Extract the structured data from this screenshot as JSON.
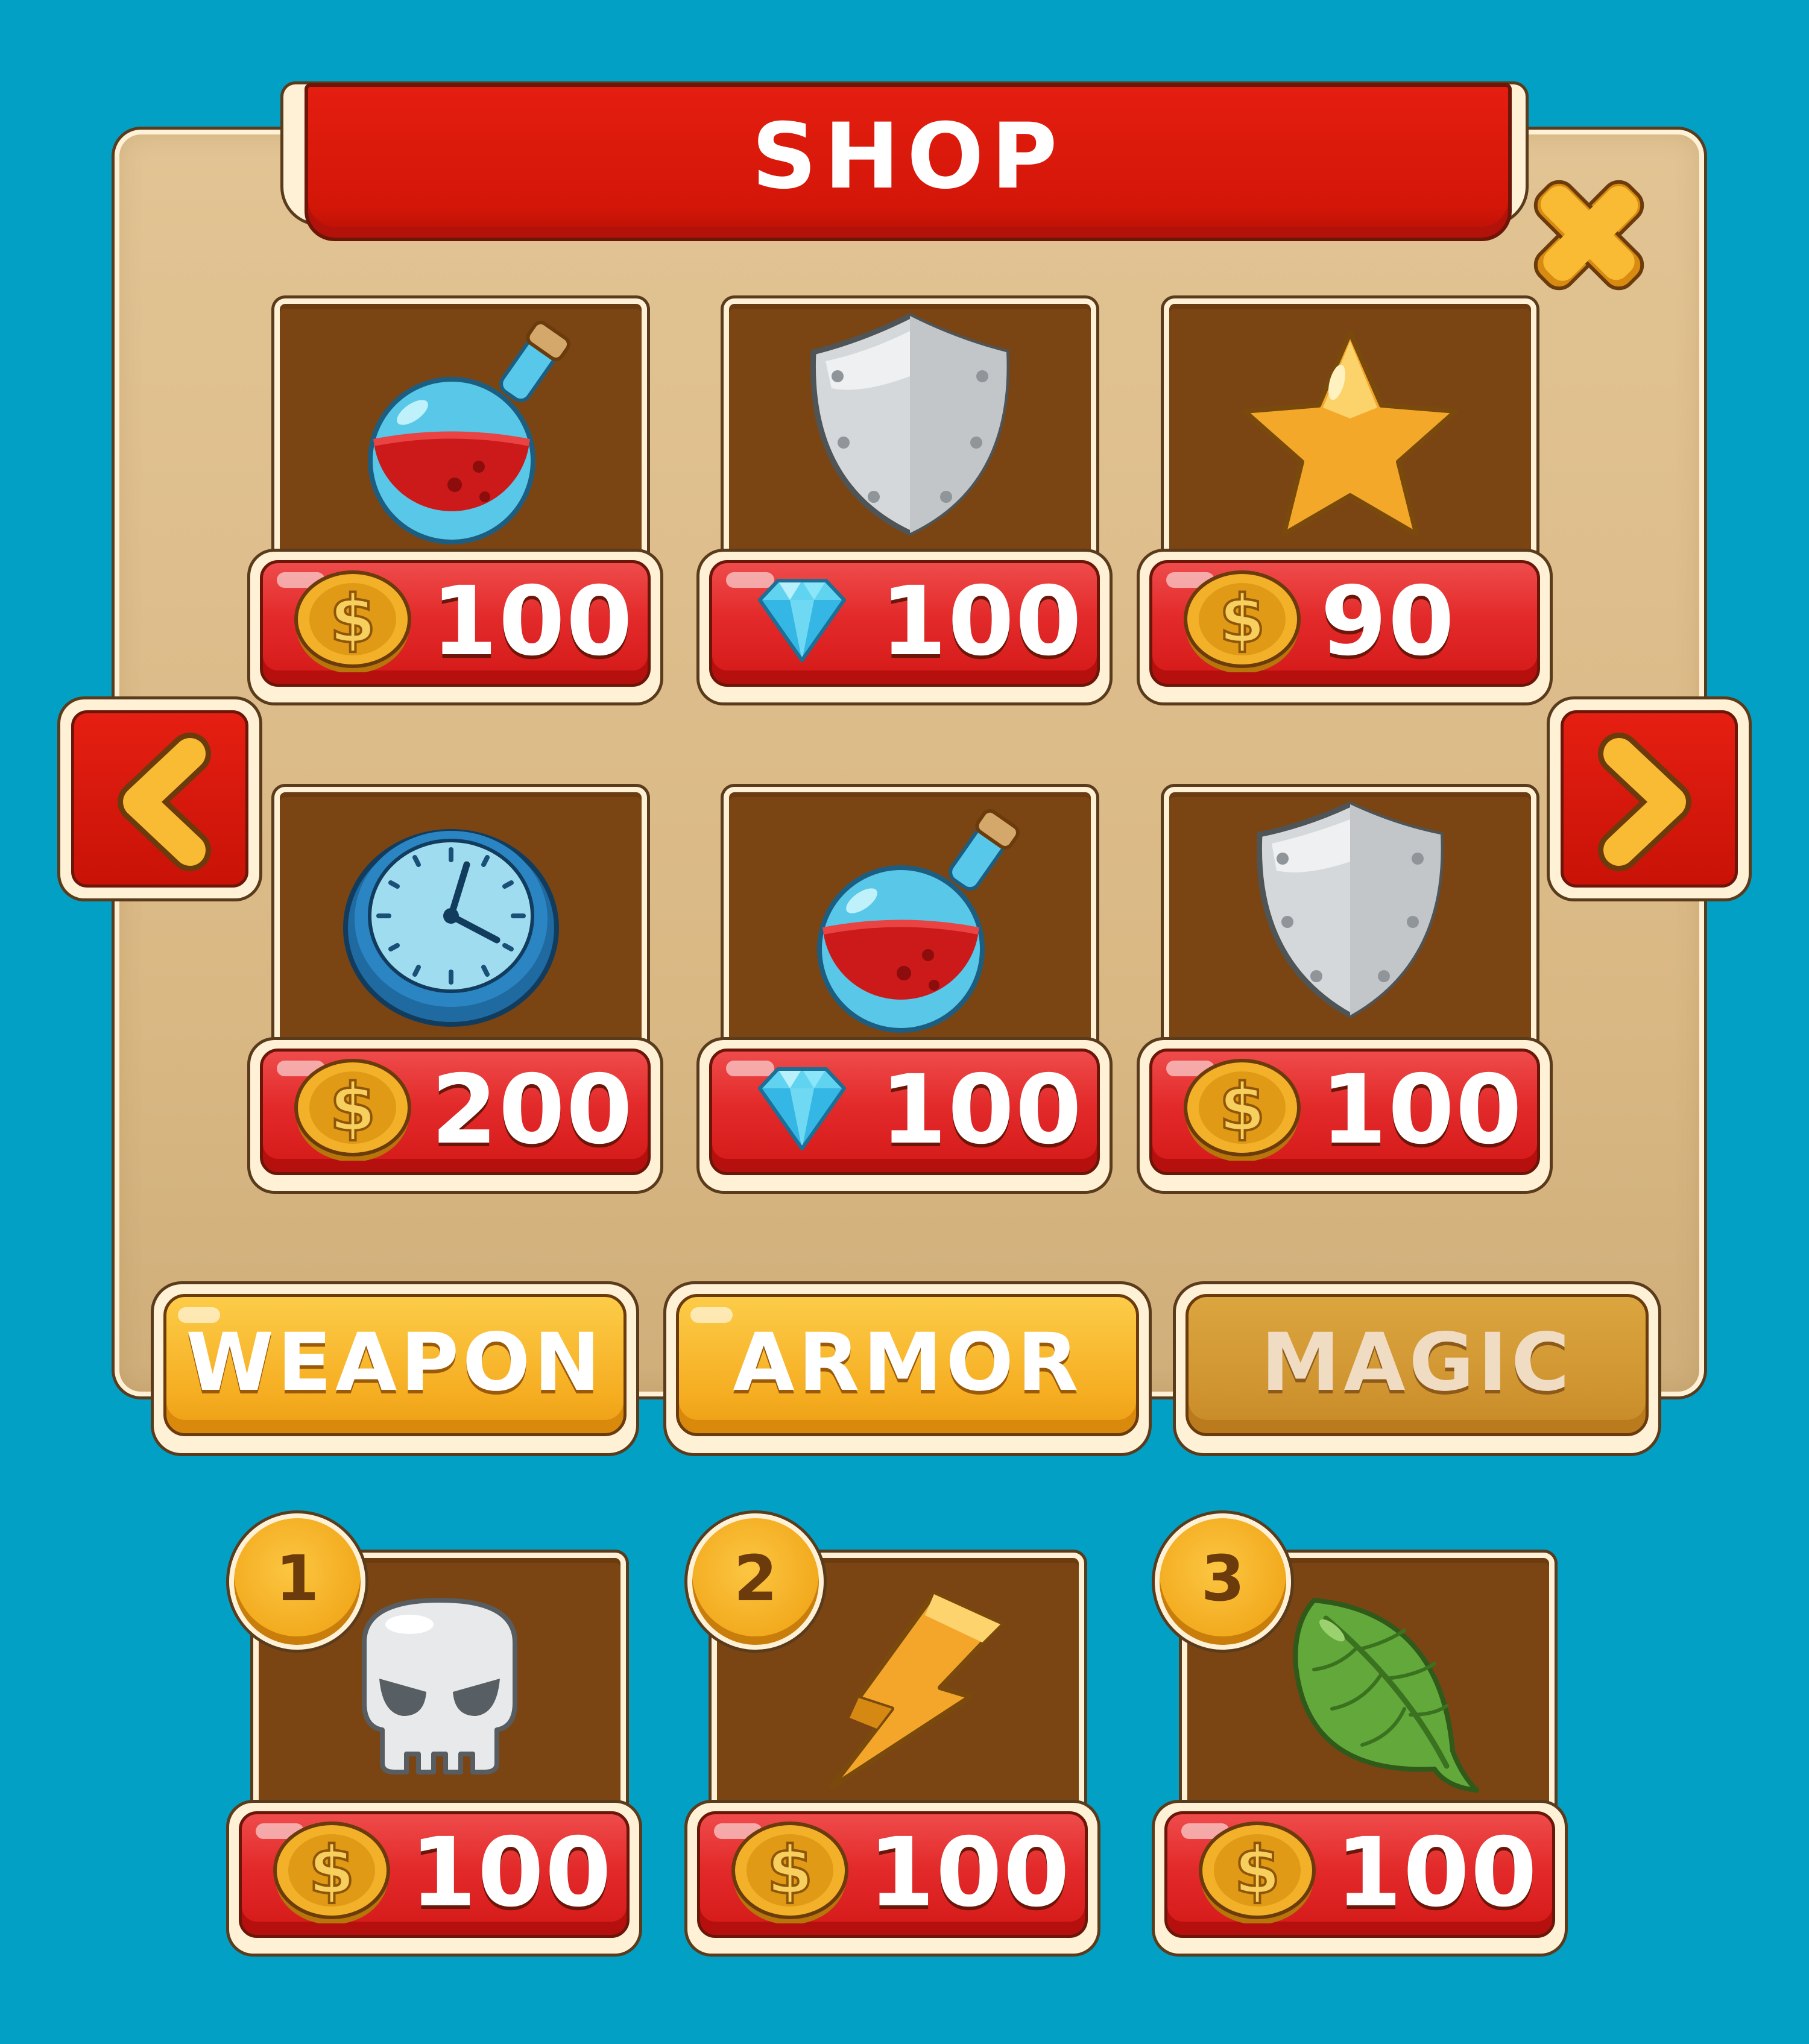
{
  "title": "SHOP",
  "colors": {
    "background": "#03a0c6",
    "panel": "#d9b884",
    "ribbon": "#d31608",
    "tile": "#7a4513",
    "price_button": "#e32a2a",
    "category_button": "#f6ae22"
  },
  "nav": {
    "prev_icon": "chevron-left-icon",
    "next_icon": "chevron-right-icon",
    "close_icon": "close-icon"
  },
  "items": [
    {
      "icon": "potion-icon",
      "currency": "coin-icon",
      "price": "100"
    },
    {
      "icon": "shield-icon",
      "currency": "diamond-icon",
      "price": "100"
    },
    {
      "icon": "star-icon",
      "currency": "coin-icon",
      "price": "90"
    },
    {
      "icon": "clock-icon",
      "currency": "coin-icon",
      "price": "200"
    },
    {
      "icon": "potion-icon",
      "currency": "diamond-icon",
      "price": "100"
    },
    {
      "icon": "shield-icon",
      "currency": "coin-icon",
      "price": "100"
    }
  ],
  "categories": [
    {
      "label": "WEAPON",
      "active": true
    },
    {
      "label": "ARMOR",
      "active": true
    },
    {
      "label": "MAGIC",
      "active": false
    }
  ],
  "slots": [
    {
      "number": "1",
      "icon": "skull-icon",
      "currency": "coin-icon",
      "price": "100"
    },
    {
      "number": "2",
      "icon": "lightning-icon",
      "currency": "coin-icon",
      "price": "100"
    },
    {
      "number": "3",
      "icon": "leaf-icon",
      "currency": "coin-icon",
      "price": "100"
    }
  ]
}
